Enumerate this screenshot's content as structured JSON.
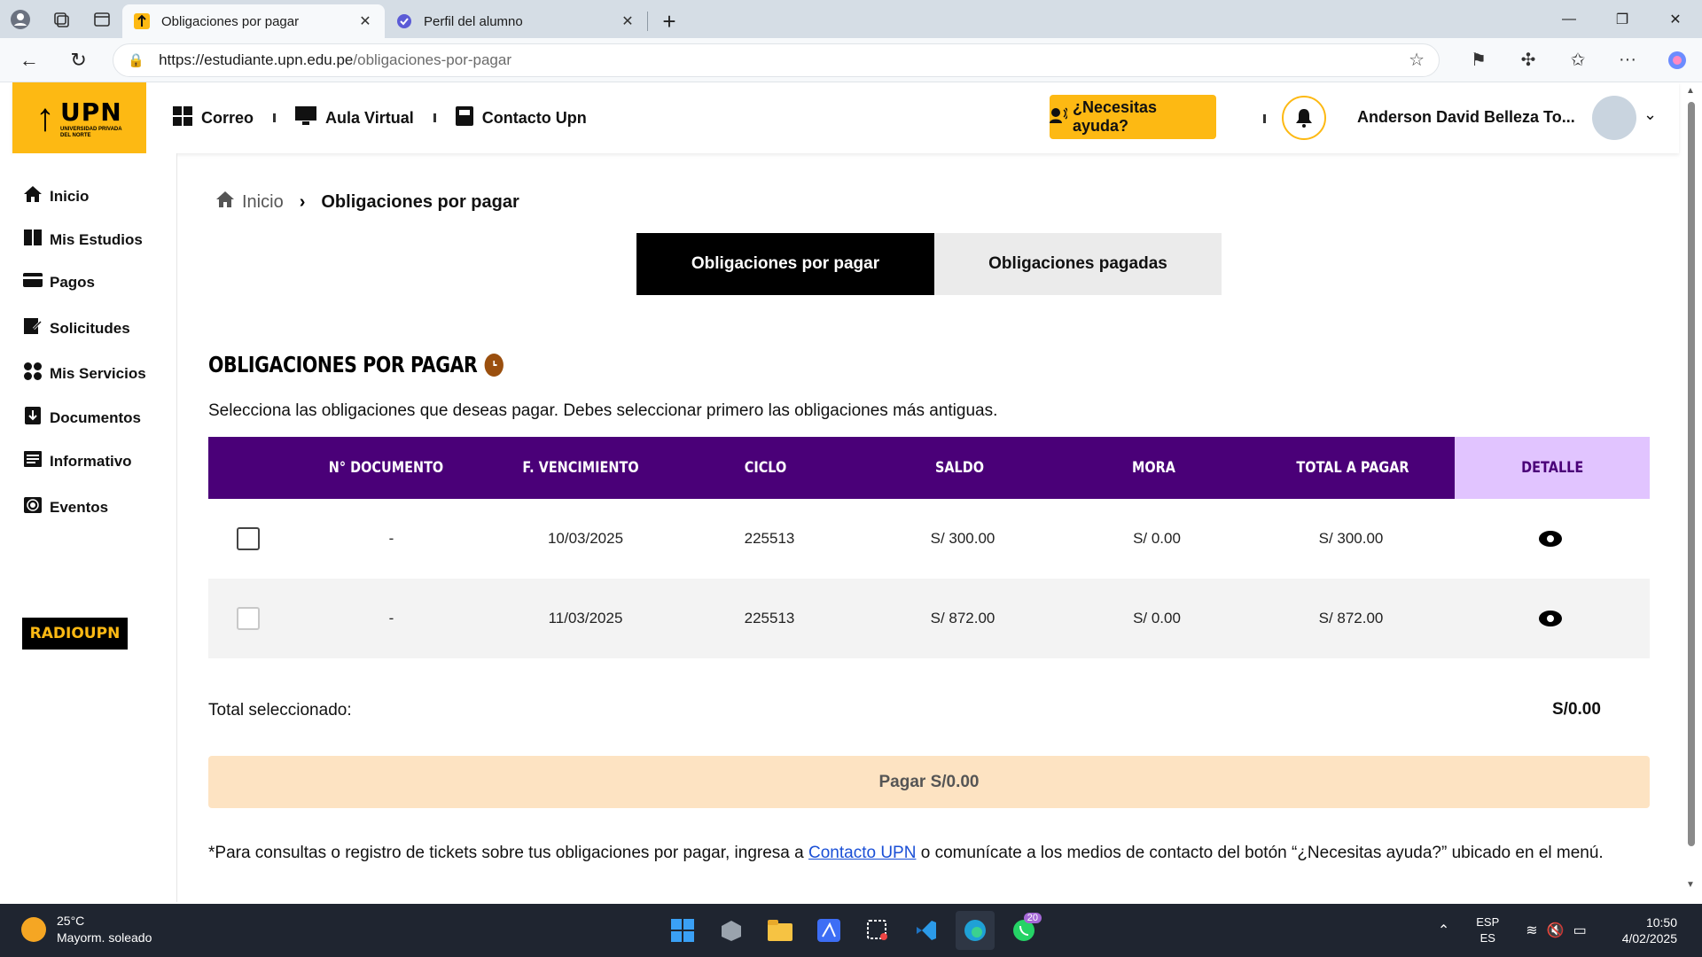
{
  "browser": {
    "tabs": [
      {
        "title": "Obligaciones por pagar",
        "active": true
      },
      {
        "title": "Perfil del alumno",
        "active": false
      }
    ],
    "url_host": "https://estudiante.upn.edu.pe",
    "url_path": "/obligaciones-por-pagar"
  },
  "header": {
    "logo": {
      "text": "UPN",
      "subtitle": "UNIVERSIDAD PRIVADA DEL NORTE"
    },
    "nav": [
      "Correo",
      "Aula Virtual",
      "Contacto Upn"
    ],
    "help_label": "¿Necesitas ayuda?",
    "user_name": "Anderson David Belleza To..."
  },
  "sidebar": {
    "items": [
      "Inicio",
      "Mis Estudios",
      "Pagos",
      "Solicitudes",
      "Mis Servicios",
      "Documentos",
      "Informativo",
      "Eventos"
    ],
    "radio_label": "RADIOUPN"
  },
  "breadcrumb": {
    "home": "Inicio",
    "current": "Obligaciones por pagar"
  },
  "tabs": {
    "pending": "Obligaciones por pagar",
    "paid": "Obligaciones pagadas"
  },
  "section": {
    "title": "OBLIGACIONES POR PAGAR",
    "subtitle": "Selecciona las obligaciones que deseas pagar. Debes seleccionar primero las obligaciones más antiguas."
  },
  "table": {
    "headers": [
      "N° DOCUMENTO",
      "F. VENCIMIENTO",
      "CICLO",
      "SALDO",
      "MORA",
      "TOTAL A PAGAR",
      "DETALLE"
    ],
    "rows": [
      {
        "documento": "-",
        "vencimiento": "10/03/2025",
        "ciclo": "225513",
        "saldo": "S/ 300.00",
        "mora": "S/ 0.00",
        "total": "S/ 300.00"
      },
      {
        "documento": "-",
        "vencimiento": "11/03/2025",
        "ciclo": "225513",
        "saldo": "S/ 872.00",
        "mora": "S/ 0.00",
        "total": "S/ 872.00"
      }
    ]
  },
  "summary": {
    "total_label": "Total seleccionado:",
    "total_value": "S/0.00",
    "pay_label": "Pagar S/0.00"
  },
  "note": {
    "before": "*Para consultas o registro de tickets sobre tus obligaciones por pagar, ingresa a ",
    "link": "Contacto UPN",
    "after": "  o comunícate a los medios de contacto del botón “¿Necesitas ayuda?” ubicado en el menú."
  },
  "taskbar": {
    "temp": "25°C",
    "weather": "Mayorm. soleado",
    "lang1": "ESP",
    "lang2": "ES",
    "time": "10:50",
    "date": "4/02/2025",
    "whatsapp_badge": "20"
  },
  "colors": {
    "brand_yellow": "#fdb913",
    "header_purple": "#4a0078",
    "detalle_lilac": "#e1c4ff",
    "pay_disabled": "#fde3c2"
  }
}
